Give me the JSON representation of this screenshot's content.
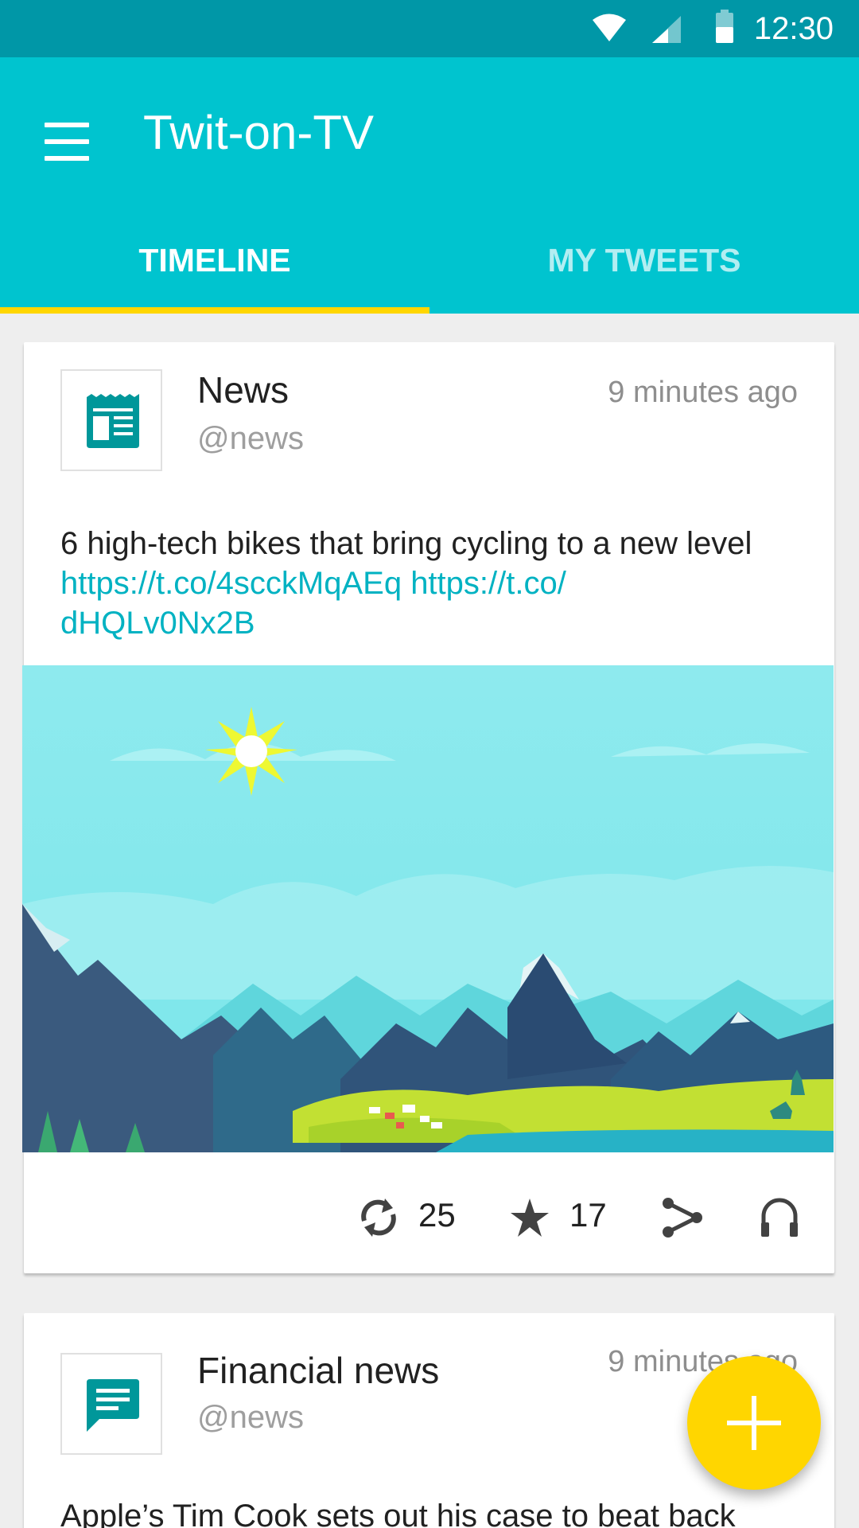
{
  "status_bar": {
    "time": "12:30"
  },
  "app_bar": {
    "title": "Twit-on-TV"
  },
  "tabs": [
    {
      "label": "TIMELINE",
      "selected": true
    },
    {
      "label": "MY TWEETS",
      "selected": false
    }
  ],
  "colors": {
    "primary": "#00c4cf",
    "primary_dark": "#0097a7",
    "accent": "#ffd600",
    "link": "#00b2c2"
  },
  "tweets": [
    {
      "author": "News",
      "handle": "@news",
      "time": "9 minutes ago",
      "avatar_icon": "newspaper-icon",
      "text": "6 high-tech bikes that bring cycling to a new level",
      "link1": "https://t.co/4scckMqAEq",
      "link2": "https://t.co/",
      "link3": "dHQLv0Nx2B",
      "image": "mountain-landscape-illustration",
      "retweets": "25",
      "favorites": "17"
    },
    {
      "author": "Financial news",
      "handle": "@news",
      "time": "9 minutes ago",
      "avatar_icon": "chat-bubble-icon",
      "text": "Apple’s Tim Cook sets out his case to beat back"
    }
  ],
  "fab": {
    "icon": "plus-icon"
  }
}
